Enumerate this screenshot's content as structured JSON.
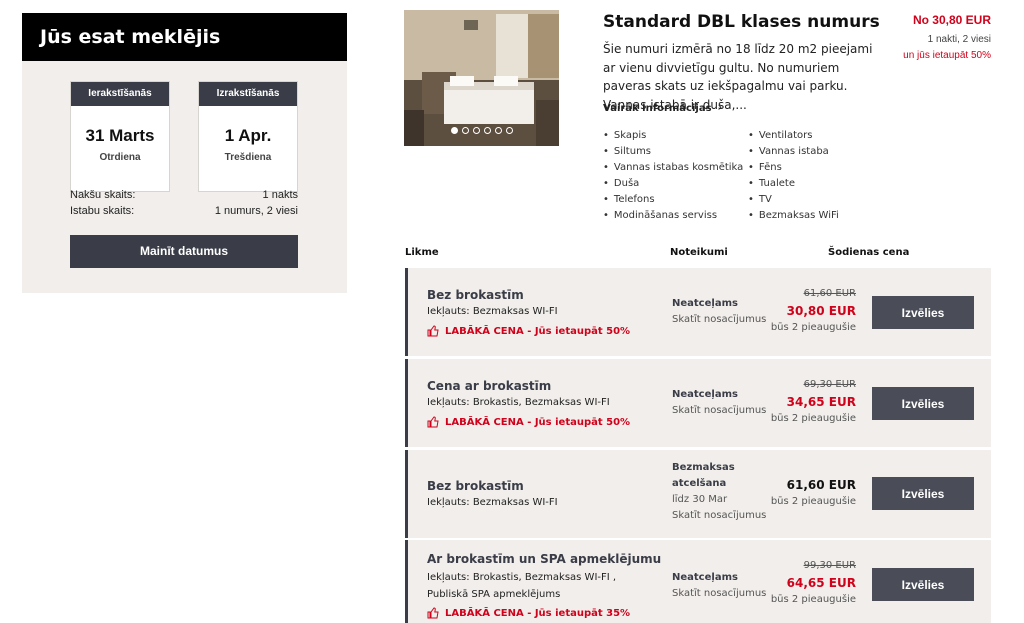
{
  "search": {
    "title": "Jūs esat meklējis",
    "checkin_label": "Ierakstīšanās",
    "checkin_date": "31 Marts",
    "checkin_day": "Otrdiena",
    "checkout_label": "Izrakstīšanās",
    "checkout_date": "1 Apr.",
    "checkout_day": "Trešdiena",
    "nights_label": "Nakšu skaits:",
    "nights_value": "1 nakts",
    "rooms_label": "Istabu skaits:",
    "rooms_value": "1 numurs, 2 viesi",
    "change_button": "Mainīt datumus"
  },
  "room": {
    "title": "Standard DBL klases numurs",
    "description": "Šie numuri izmērā no 18 līdz 20 m2 pieejami ar vienu divvietīgu gultu. No numuriem paveras skats uz iekšpagalmu vai parku. Vannas istabā ir duša,...",
    "more_info": "Vairāk informācijas",
    "from_price": "No 30,80 EUR",
    "from_sub": "1 nakti, 2 viesi",
    "from_save": "un jūs ietaupāt 50%",
    "amenities_col1": [
      "Skapis",
      "Siltums",
      "Vannas istabas kosmētika",
      "Duša",
      "Telefons",
      "Modināšanas serviss"
    ],
    "amenities_col2": [
      "Ventilators",
      "Vannas istaba",
      "Fēns",
      "Tualete",
      "TV",
      "Bezmaksas WiFi"
    ]
  },
  "table": {
    "col_rate": "Likme",
    "col_terms": "Noteikumi",
    "col_price": "Šodienas cena"
  },
  "rates": [
    {
      "name": "Bez brokastīm",
      "included": "Iekļauts: Bezmaksas WI-FI",
      "best": "LABĀKĀ CENA - Jūs ietaupāt 50%",
      "terms_title": "Neatceļams",
      "terms_link": "Skatīt nosacījumus",
      "old_price": "61,60 EUR",
      "price": "30,80 EUR",
      "adults": "būs 2 pieaugušie",
      "button": "Izvēlies"
    },
    {
      "name": "Cena ar brokastīm",
      "included": "Iekļauts: Brokastis, Bezmaksas WI-FI",
      "best": "LABĀKĀ CENA - Jūs ietaupāt 50%",
      "terms_title": "Neatceļams",
      "terms_link": "Skatīt nosacījumus",
      "old_price": "69,30 EUR",
      "price": "34,65 EUR",
      "adults": "būs 2 pieaugušie",
      "button": "Izvēlies"
    },
    {
      "name": "Bez brokastīm",
      "included": "Iekļauts: Bezmaksas WI-FI",
      "terms_title": "Bezmaksas atcelšana",
      "terms_date": "līdz 30 Mar",
      "terms_link": "Skatīt nosacījumus",
      "price": "61,60 EUR",
      "adults": "būs 2 pieaugušie",
      "button": "Izvēlies"
    },
    {
      "name": "Ar brokastīm un SPA apmeklējumu",
      "included": "Iekļauts: Brokastis, Bezmaksas WI-FI , Publiskā SPA apmeklējums",
      "best": "LABĀKĀ CENA - Jūs ietaupāt 35%",
      "terms_title": "Neatceļams",
      "terms_link": "Skatīt nosacījumus",
      "old_price": "99,30 EUR",
      "price": "64,65 EUR",
      "adults": "būs 2 pieaugušie",
      "button": "Izvēlies"
    }
  ],
  "colors": {
    "accent_red": "#d0021b",
    "dark_slate": "#3a3d47",
    "panel_bg": "#f1eeeb"
  },
  "icons": [
    "thumbs-up-icon",
    "chevron-right-icon",
    "carousel-dot-icon"
  ]
}
